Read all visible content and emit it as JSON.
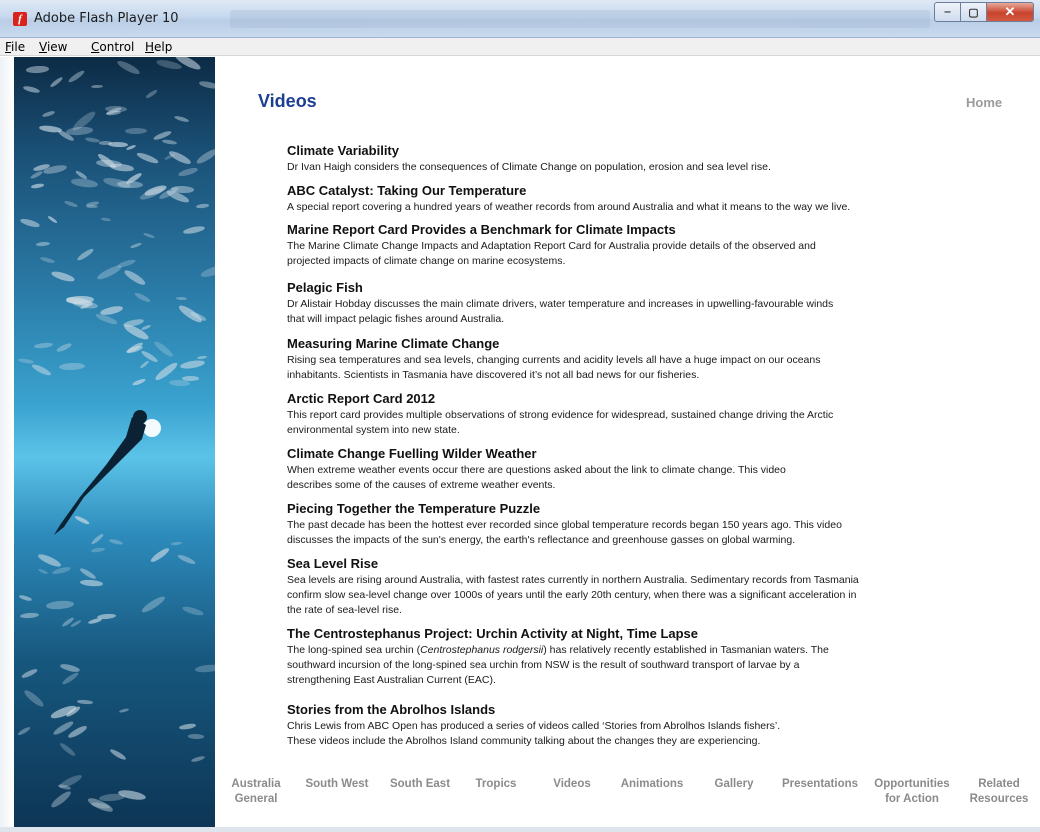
{
  "window": {
    "title": "Adobe Flash Player 10",
    "app_icon_glyph": "f",
    "minimize_glyph": "‒",
    "maximize_glyph": "▢",
    "close_glyph": "✕"
  },
  "menu": [
    {
      "accel": "F",
      "rest": "ile"
    },
    {
      "accel": "V",
      "rest": "iew"
    },
    {
      "accel": "C",
      "rest": "ontrol"
    },
    {
      "accel": "H",
      "rest": "elp"
    }
  ],
  "page": {
    "title": "Videos",
    "home_label": "Home"
  },
  "videos": [
    {
      "title": "Climate Variability",
      "lines": [
        "Dr Ivan Haigh considers the consequences of Climate Change on population, erosion and sea level rise."
      ]
    },
    {
      "title": "ABC Catalyst: Taking Our Temperature",
      "lines": [
        "A special report covering a hundred years of weather records from around Australia and what it means to the way we live."
      ]
    },
    {
      "title": "Marine Report Card Provides a Benchmark for Climate Impacts",
      "lines": [
        "The Marine Climate Change Impacts and Adaptation Report Card for Australia provide details of the observed and",
        "projected impacts of climate change on marine ecosystems."
      ]
    },
    {
      "title": "Pelagic Fish",
      "lines": [
        "Dr Alistair Hobday discusses the main climate drivers, water temperature and increases in upwelling-favourable winds",
        "that will impact pelagic fishes around Australia."
      ]
    },
    {
      "title": "Measuring Marine Climate Change",
      "lines": [
        "Rising sea temperatures and sea levels, changing currents and acidity levels all have a huge impact on our oceans",
        "inhabitants. Scientists in Tasmania have discovered it’s not all bad news for our fisheries."
      ]
    },
    {
      "title": "Arctic Report Card 2012",
      "lines": [
        "This report card provides multiple observations of strong evidence for widespread, sustained change driving the Arctic",
        "environmental system into new state."
      ]
    },
    {
      "title": "Climate Change Fuelling Wilder Weather",
      "lines": [
        "When extreme weather events occur there are questions asked about the link to climate change. This video",
        "describes some of the causes of extreme weather events."
      ]
    },
    {
      "title": "Piecing Together the Temperature Puzzle",
      "lines": [
        "The past decade has been the hottest ever recorded since global temperature records began 150 years ago. This video",
        "discusses the impacts of the sun's energy, the earth's reflectance and greenhouse gasses on global warming."
      ]
    },
    {
      "title": "Sea Level Rise",
      "lines": [
        "Sea levels are rising around Australia, with fastest rates currently in northern Australia. Sedimentary records from Tasmania",
        "confirm slow sea-level change over 1000s of years until the early 20th century, when there was a significant acceleration in",
        "the rate of sea-level rise."
      ]
    },
    {
      "title": "The Centrostephanus Project: Urchin Activity at Night, Time Lapse",
      "line1_before": "The long-spined sea urchin (",
      "line1_italic": "Centrostephanus rodgersii",
      "line1_after": ") has relatively recently established in Tasmanian waters. The",
      "lines": [
        "southward incursion of the long-spined sea urchin from NSW is the result of southward transport of larvae by a",
        "strengthening East Australian Current (EAC)."
      ]
    },
    {
      "title": "Stories from the Abrolhos Islands",
      "lines": [
        "Chris Lewis from ABC Open has produced a series of videos called ‘Stories from Abrolhos Islands fishers’.",
        "These videos include the Abrolhos Island community talking about the changes they are experiencing."
      ]
    }
  ],
  "footer_nav": [
    {
      "line1": "Australia",
      "line2": "General"
    },
    {
      "line1": "South West",
      "line2": ""
    },
    {
      "line1": "South East",
      "line2": ""
    },
    {
      "line1": "Tropics",
      "line2": ""
    },
    {
      "line1": "Videos",
      "line2": ""
    },
    {
      "line1": "Animations",
      "line2": ""
    },
    {
      "line1": "Gallery",
      "line2": ""
    },
    {
      "line1": "Presentations",
      "line2": ""
    },
    {
      "line1": "Opportunities",
      "line2": "for Action"
    },
    {
      "line1": "Related",
      "line2": "Resources"
    }
  ],
  "colors": {
    "title_blue": "#1c3f94",
    "nav_gray": "#8b8b8b",
    "home_gray": "#9a9a9a"
  },
  "photo_description_icon": "diver-with-fish-school-photo"
}
